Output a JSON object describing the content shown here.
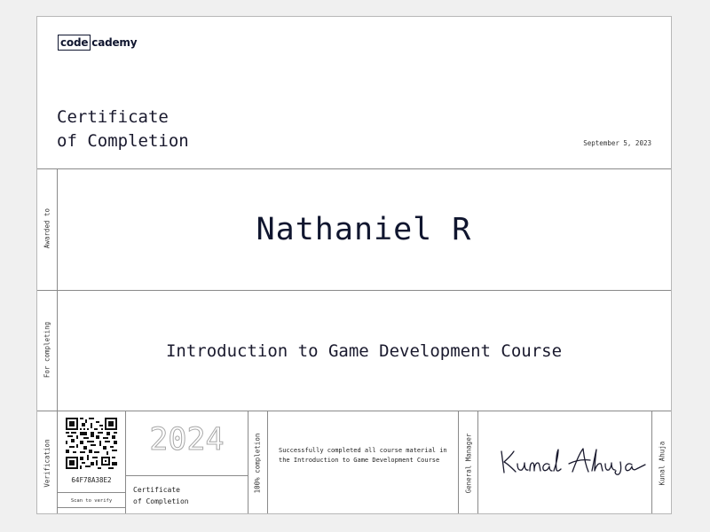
{
  "logo": {
    "part1": "code",
    "part2": "cademy"
  },
  "title": {
    "line1": "Certificate",
    "line2": "of Completion"
  },
  "date": "September 5, 2023",
  "labels": {
    "awarded_to": "Awarded to",
    "for_completing": "For completing",
    "verification": "Verification",
    "completion": "100% completion",
    "general_manager": "General Manager",
    "signer_name": "Kunal Ahuja"
  },
  "recipient_name": "Nathaniel R",
  "course_name": "Introduction to Game Development Course",
  "verification": {
    "id": "64F78A38E2",
    "scan_text": "Scan to verify"
  },
  "year": "2024",
  "certificate_small": {
    "line1": "Certificate",
    "line2": "of Completion"
  },
  "description": "Successfully completed all course material in the Introduction to Game Development Course",
  "signature_text": "Kunal Ahuja",
  "colors": {
    "ink": "#10162f",
    "rule": "#8a8a8a",
    "background": "#f0f0f0",
    "paper": "#ffffff"
  }
}
